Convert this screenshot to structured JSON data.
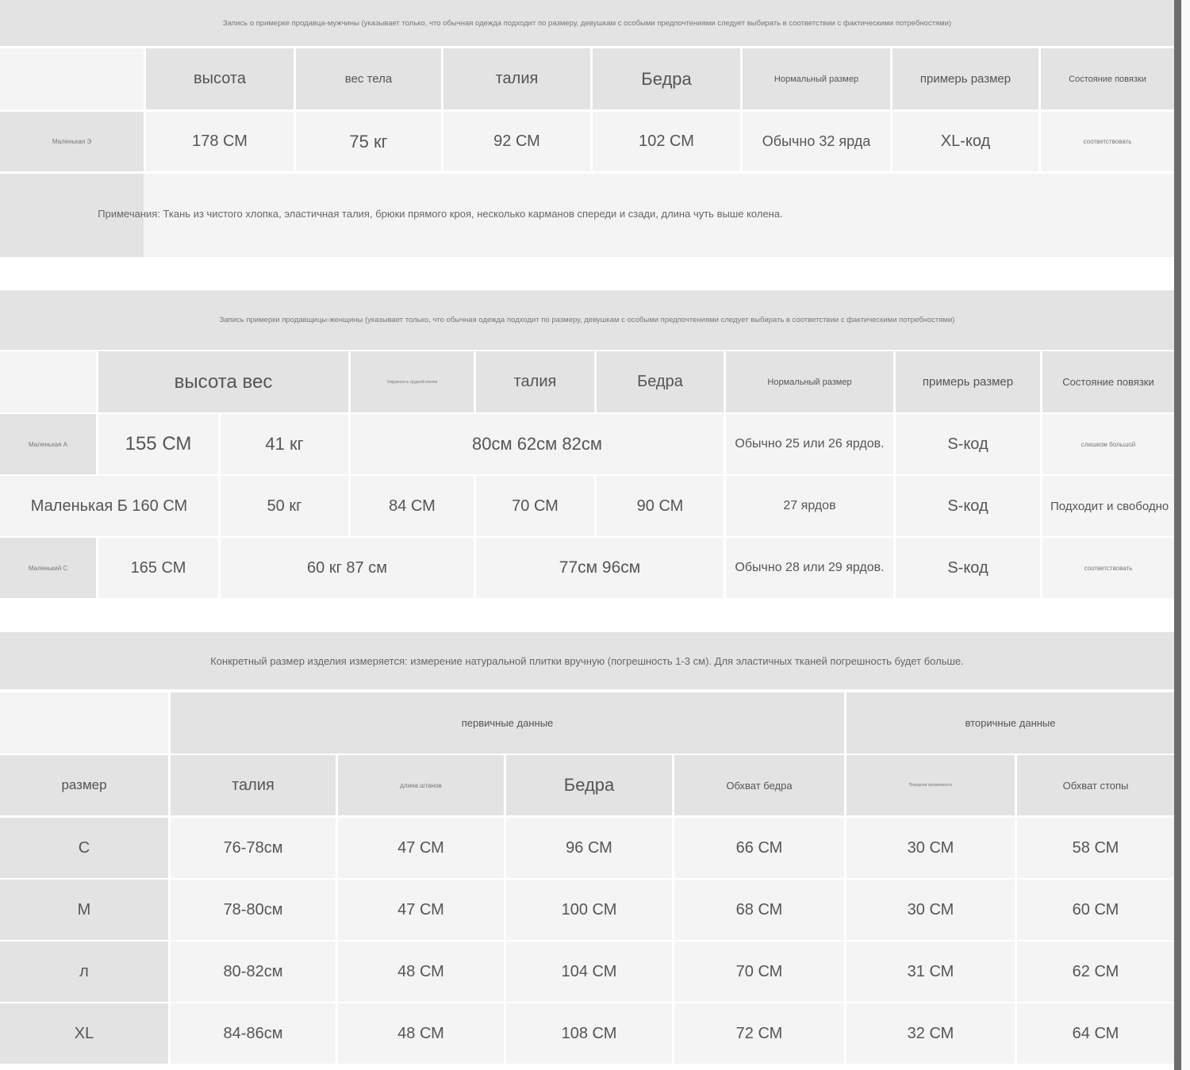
{
  "men": {
    "caption": "Запись о примерке продавца-мужчины (указывает только, что обычная одежда подходит по размеру, девушкам с особыми предпочтениями следует выбирать в соответствии с фактическими потребностями)",
    "headers": [
      "высота",
      "вес тела",
      "талия",
      "Бедра",
      "Нормальный размер",
      "примерь размер",
      "Состояние повязки"
    ],
    "row": {
      "name": "Маленькая Э",
      "height": "178 СМ",
      "weight": "75 кг",
      "waist": "92 СМ",
      "hips": "102 СМ",
      "normal_size": "Обычно 32 ярда",
      "try_size": "XL-код",
      "fit": "соответствовать"
    },
    "notes": "Примечания: Ткань из чистого хлопка, эластичная талия, брюки прямого кроя, несколько карманов спереди и сзади, длина чуть выше колена."
  },
  "women": {
    "caption": "Запись примерки продавщицы-женщины (указывает только, что обычная одежда подходит по размеру, девушкам с особыми предпочтениями следует выбирать в соответствии с фактическими потребностями)",
    "headers": [
      "высота вес",
      "Окружность грудной клетки",
      "талия",
      "Бедра",
      "Нормальный размер",
      "примерь размер",
      "Состояние повязки"
    ],
    "row_a": {
      "name": "Маленькая А",
      "height": "155 СМ",
      "weight": "41 кг",
      "measures": "80см 62см 82см",
      "normal_size": "Обычно 25 или 26 ярдов.",
      "try_size": "S-код",
      "fit": "слишком большой"
    },
    "row_b": {
      "name_height": "Маленькая Б 160 СМ",
      "weight": "50 кг",
      "chest": "84 СМ",
      "waist": "70 СМ",
      "hips": "90 СМ",
      "normal_size": "27 ярдов",
      "try_size": "S-код",
      "fit": "Подходит и свободно"
    },
    "row_c": {
      "name": "Маленький С",
      "height": "165 СМ",
      "weight_chest": "60 кг 87 см",
      "waist_hips": "77см 96см",
      "normal_size": "Обычно 28 или 29 ярдов.",
      "try_size": "S-код",
      "fit": "соответствовать"
    }
  },
  "product": {
    "caption": "Конкретный размер изделия измеряется: измерение натуральной плитки вручную (погрешность 1-3 см). Для эластичных тканей погрешность будет больше.",
    "group_primary": "первичные данные",
    "group_secondary": "вторичные данные",
    "headers": [
      "размер",
      "талия",
      "длина штанов",
      "Бедра",
      "Обхват бедра",
      "Передняя промежность",
      "Обхват стопы"
    ],
    "rows": [
      [
        "С",
        "76-78см",
        "47 СМ",
        "96 СМ",
        "66 СМ",
        "30 СМ",
        "58 СМ"
      ],
      [
        "М",
        "78-80см",
        "47 СМ",
        "100 СМ",
        "68 СМ",
        "30 СМ",
        "60 СМ"
      ],
      [
        "л",
        "80-82см",
        "48 СМ",
        "104 СМ",
        "70 СМ",
        "31 СМ",
        "62 СМ"
      ],
      [
        "XL",
        "84-86см",
        "48 СМ",
        "108 СМ",
        "72 СМ",
        "32 СМ",
        "64 СМ"
      ]
    ]
  }
}
